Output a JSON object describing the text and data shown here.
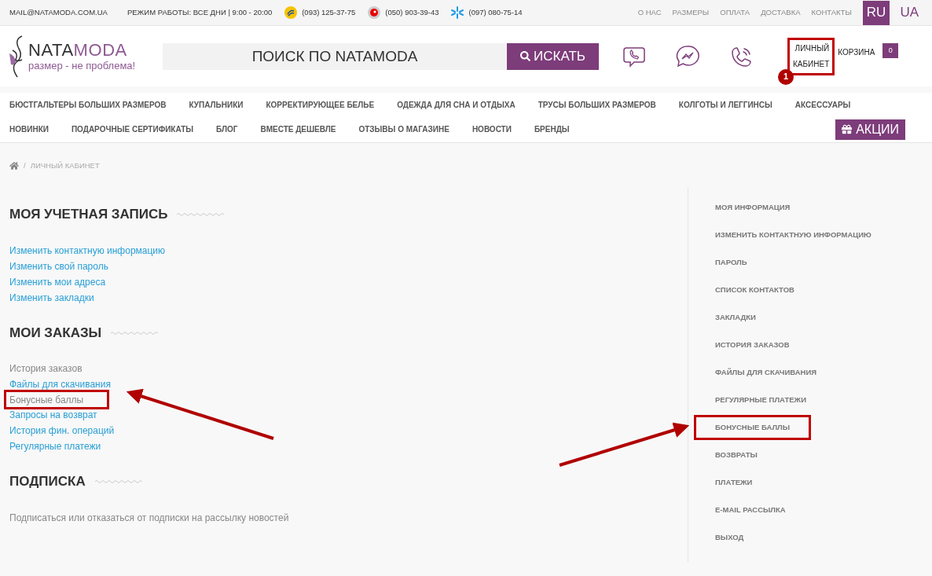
{
  "top_bar": {
    "email": "MAIL@NATAMODA.COM.UA",
    "hours": "РЕЖИМ РАБОТЫ: ВСЕ ДНИ | 9:00 - 20:00",
    "phones": [
      {
        "kind": "lifecell",
        "number": "(093) 125-37-75"
      },
      {
        "kind": "vodafone",
        "number": "(050) 903-39-43"
      },
      {
        "kind": "kyivstar",
        "number": "(097) 080-75-14"
      }
    ],
    "links": [
      "О НАС",
      "РАЗМЕРЫ",
      "ОПЛАТА",
      "ДОСТАВКА",
      "КОНТАКТЫ"
    ],
    "languages": [
      {
        "label": "RU",
        "selected": true
      },
      {
        "label": "UA",
        "selected": false
      }
    ]
  },
  "header": {
    "logo": {
      "name_left": "NATA",
      "name_right": "MODA",
      "tagline": "размер - не проблема!"
    },
    "search": {
      "placeholder": "ПОИСК ПО NATAMODA",
      "button": "ИСКАТЬ"
    },
    "account": {
      "line1": "ЛИЧНЫЙ",
      "line2": "КАБИНЕТ",
      "highlighted": true,
      "badge": "1"
    },
    "cart": {
      "label": "КОРЗИНА",
      "count": "0"
    }
  },
  "nav": {
    "row1": [
      "БЮСТГАЛЬТЕРЫ БОЛЬШИХ РАЗМЕРОВ",
      "КУПАЛЬНИКИ",
      "КОРРЕКТИРУЮЩЕЕ БЕЛЬЕ",
      "ОДЕЖДА ДЛЯ СНА И ОТДЫХА",
      "ТРУСЫ БОЛЬШИХ РАЗМЕРОВ",
      "КОЛГОТЫ И ЛЕГГИНСЫ",
      "АКСЕССУАРЫ"
    ],
    "row2": [
      "НОВИНКИ",
      "ПОДАРОЧНЫЕ СЕРТИФИКАТЫ",
      "БЛОГ",
      "ВМЕСТЕ ДЕШЕВЛЕ",
      "ОТЗЫВЫ О МАГАЗИНЕ",
      "НОВОСТИ",
      "БРЕНДЫ"
    ],
    "promo": "АКЦИИ"
  },
  "breadcrumb": {
    "separator": "/",
    "items": [
      "ЛИЧНЫЙ КАБИНЕТ"
    ]
  },
  "sections": [
    {
      "title": "МОЯ УЧЕТНАЯ ЗАПИСЬ",
      "links": [
        {
          "label": "Изменить контактную информацию",
          "current": false,
          "highlighted": false
        },
        {
          "label": "Изменить свой пароль",
          "current": false,
          "highlighted": false
        },
        {
          "label": "Изменить мои адреса",
          "current": false,
          "highlighted": false
        },
        {
          "label": "Изменить закладки",
          "current": false,
          "highlighted": false
        }
      ]
    },
    {
      "title": "МОИ ЗАКАЗЫ",
      "links": [
        {
          "label": "История заказов",
          "current": true,
          "highlighted": false
        },
        {
          "label": "Файлы для скачивания",
          "current": false,
          "highlighted": false
        },
        {
          "label": "Бонусные баллы",
          "current": true,
          "highlighted": true
        },
        {
          "label": "Запросы на возврат",
          "current": false,
          "highlighted": false
        },
        {
          "label": "История фин. операций",
          "current": false,
          "highlighted": false
        },
        {
          "label": "Регулярные платежи",
          "current": false,
          "highlighted": false
        }
      ]
    },
    {
      "title": "ПОДПИСКА",
      "links": [
        {
          "label": "Подписаться или отказаться от подписки на рассылку новостей",
          "current": true,
          "highlighted": false
        }
      ]
    }
  ],
  "sidebar": {
    "items": [
      {
        "label": "МОЯ ИНФОРМАЦИЯ",
        "highlighted": false
      },
      {
        "label": "ИЗМЕНИТЬ КОНТАКТНУЮ ИНФОРМАЦИЮ",
        "highlighted": false
      },
      {
        "label": "ПАРОЛЬ",
        "highlighted": false
      },
      {
        "label": "СПИСОК КОНТАКТОВ",
        "highlighted": false
      },
      {
        "label": "ЗАКЛАДКИ",
        "highlighted": false
      },
      {
        "label": "ИСТОРИЯ ЗАКАЗОВ",
        "highlighted": false
      },
      {
        "label": "ФАЙЛЫ ДЛЯ СКАЧИВАНИЯ",
        "highlighted": false
      },
      {
        "label": "РЕГУЛЯРНЫЕ ПЛАТЕЖИ",
        "highlighted": false
      },
      {
        "label": "БОНУСНЫЕ БАЛЛЫ",
        "highlighted": true
      },
      {
        "label": "ВОЗВРАТЫ",
        "highlighted": false
      },
      {
        "label": "ПЛАТЕЖИ",
        "highlighted": false
      },
      {
        "label": "E-MAIL РАССЫЛКА",
        "highlighted": false
      },
      {
        "label": "ВЫХОД",
        "highlighted": false
      }
    ]
  }
}
